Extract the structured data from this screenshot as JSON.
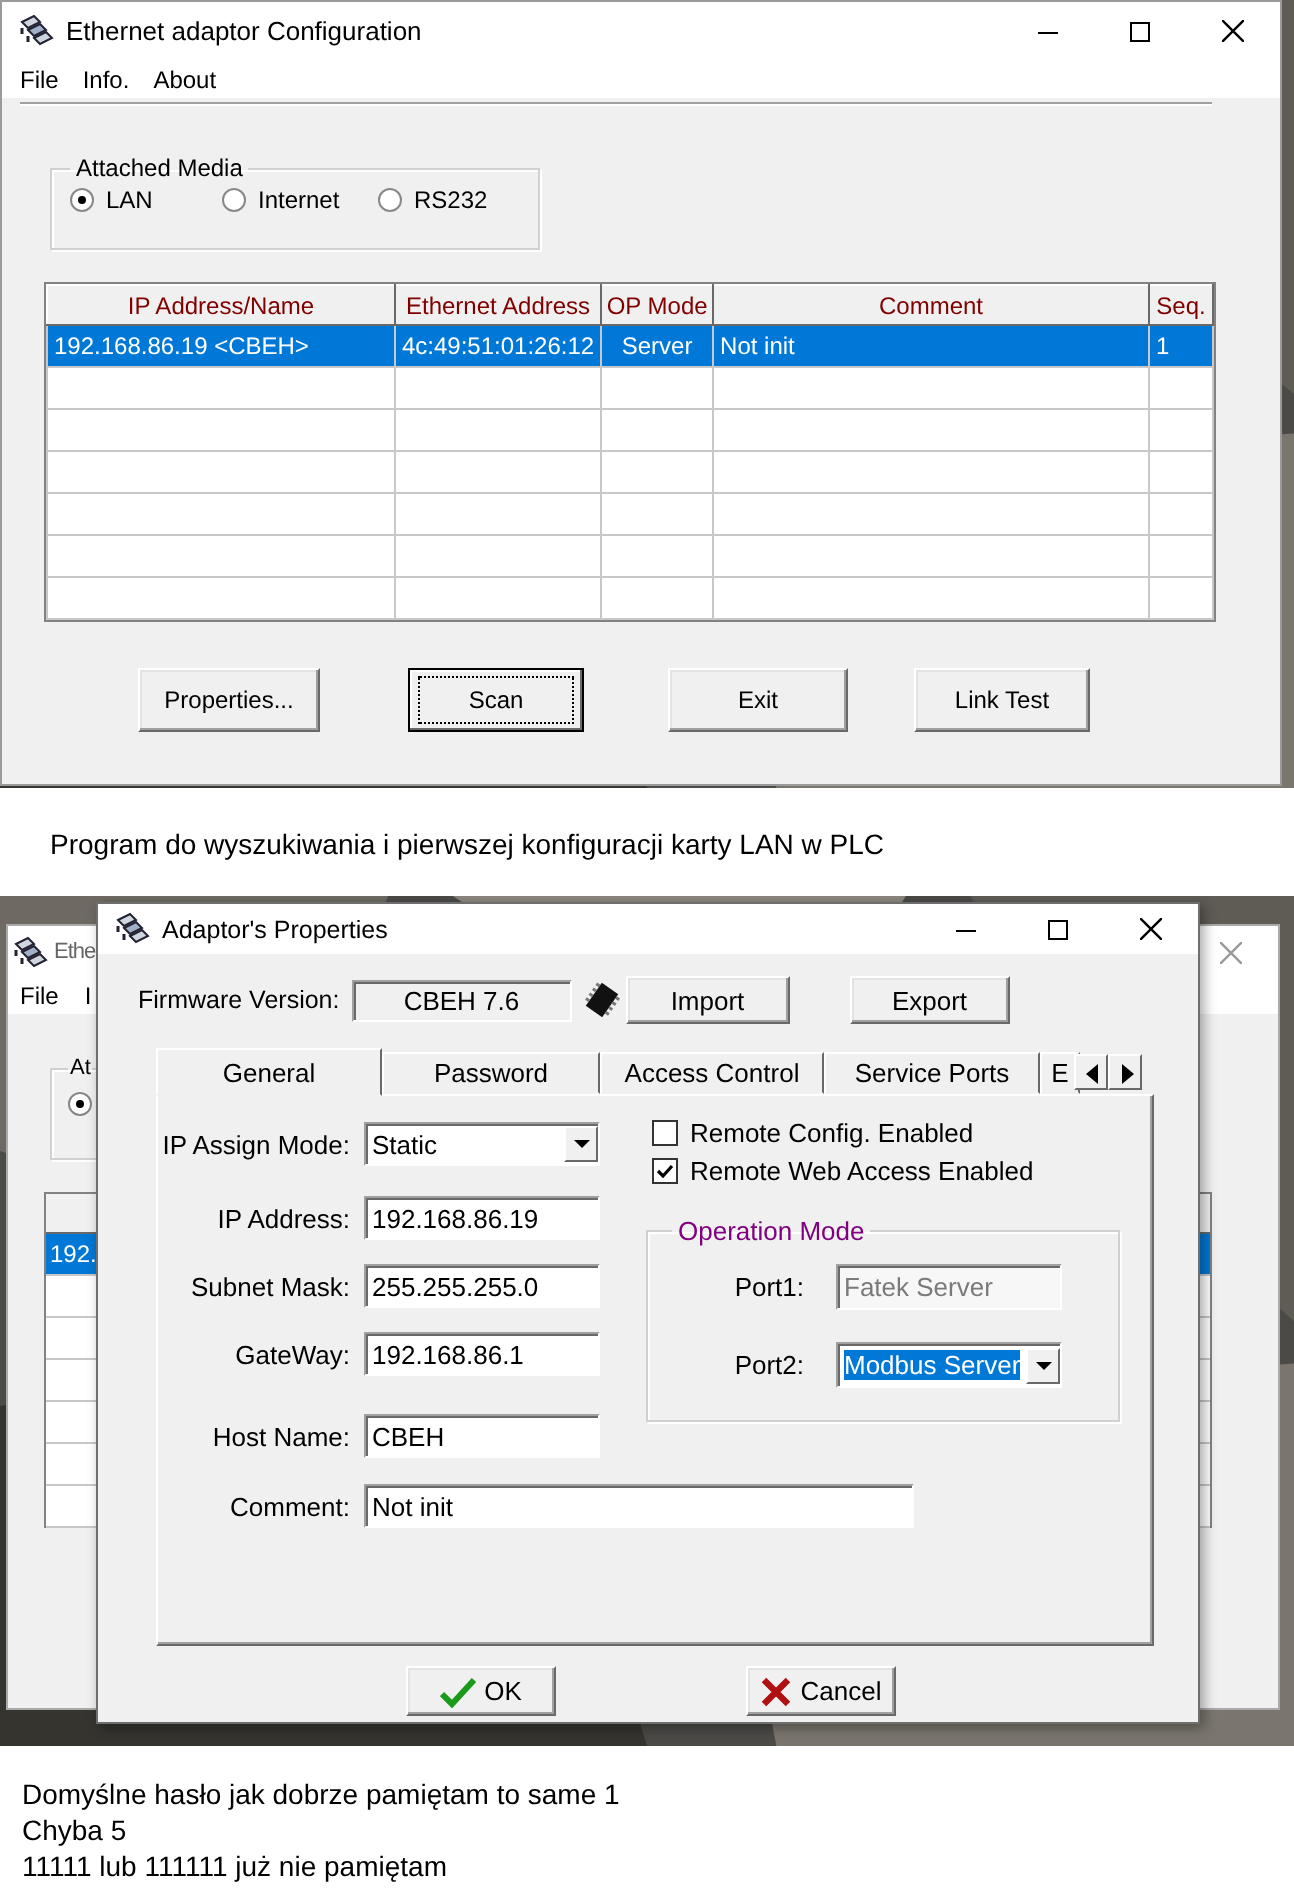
{
  "config_window": {
    "title": "Ethernet adaptor Configuration",
    "menu": [
      "File",
      "Info.",
      "About"
    ],
    "attached_media": {
      "legend": "Attached Media",
      "options": [
        {
          "label": "LAN",
          "selected": true
        },
        {
          "label": "Internet",
          "selected": false
        },
        {
          "label": "RS232",
          "selected": false
        }
      ]
    },
    "table": {
      "columns": [
        "IP Address/Name",
        "Ethernet Address",
        "OP Mode",
        "Comment",
        "Seq."
      ],
      "rows": [
        {
          "cells": [
            "192.168.86.19 <CBEH>",
            "4c:49:51:01:26:12",
            "Server",
            "Not init",
            "1"
          ],
          "selected": true
        }
      ]
    },
    "buttons": [
      {
        "label": "Properties...",
        "focused": false
      },
      {
        "label": "Scan",
        "focused": true
      },
      {
        "label": "Exit",
        "focused": false
      },
      {
        "label": "Link Test",
        "focused": false
      }
    ]
  },
  "caption": "Program do wyszukiwania i pierwszej konfiguracji karty LAN w PLC",
  "background_window": {
    "title": "Ethe",
    "menu": [
      "File",
      "I"
    ],
    "group_legend": "At",
    "radio": {
      "selected": true
    },
    "row_text": "192."
  },
  "properties_dialog": {
    "title": "Adaptor's Properties",
    "firmware": {
      "label": "Firmware Version:",
      "value": "CBEH 7.6"
    },
    "top_buttons": [
      "Import",
      "Export"
    ],
    "tabs": [
      {
        "label": "General",
        "selected": true
      },
      {
        "label": "Password",
        "selected": false
      },
      {
        "label": "Access Control",
        "selected": false
      },
      {
        "label": "Service Ports",
        "selected": false
      },
      {
        "label": "E",
        "selected": false
      }
    ],
    "fields": [
      {
        "label": "IP Assign Mode:",
        "value": "Static",
        "kind": "dropdown"
      },
      {
        "label": "IP Address:",
        "value": "192.168.86.19",
        "kind": "text"
      },
      {
        "label": "Subnet Mask:",
        "value": "255.255.255.0",
        "kind": "text"
      },
      {
        "label": "GateWay:",
        "value": "192.168.86.1",
        "kind": "text"
      },
      {
        "label": "Host Name:",
        "value": "CBEH",
        "kind": "text"
      },
      {
        "label": "Comment:",
        "value": "Not init",
        "kind": "text"
      }
    ],
    "checkboxes": [
      {
        "label": "Remote Config. Enabled",
        "checked": false
      },
      {
        "label": "Remote Web Access Enabled",
        "checked": true
      }
    ],
    "operation_mode": {
      "legend": "Operation Mode",
      "ports": [
        {
          "label": "Port1:",
          "value": "Fatek Server",
          "kind": "text",
          "disabled": true,
          "highlighted": false
        },
        {
          "label": "Port2:",
          "value": "Modbus Server",
          "kind": "dropdown",
          "disabled": false,
          "highlighted": true
        }
      ]
    },
    "buttons": [
      {
        "label": "OK",
        "kind": "ok"
      },
      {
        "label": "Cancel",
        "kind": "cancel"
      }
    ]
  },
  "notes": [
    "Domyślne hasło jak dobrze pamiętam to same 1",
    "Chyba 5",
    "11111 lub 111111 już nie pamiętam"
  ]
}
